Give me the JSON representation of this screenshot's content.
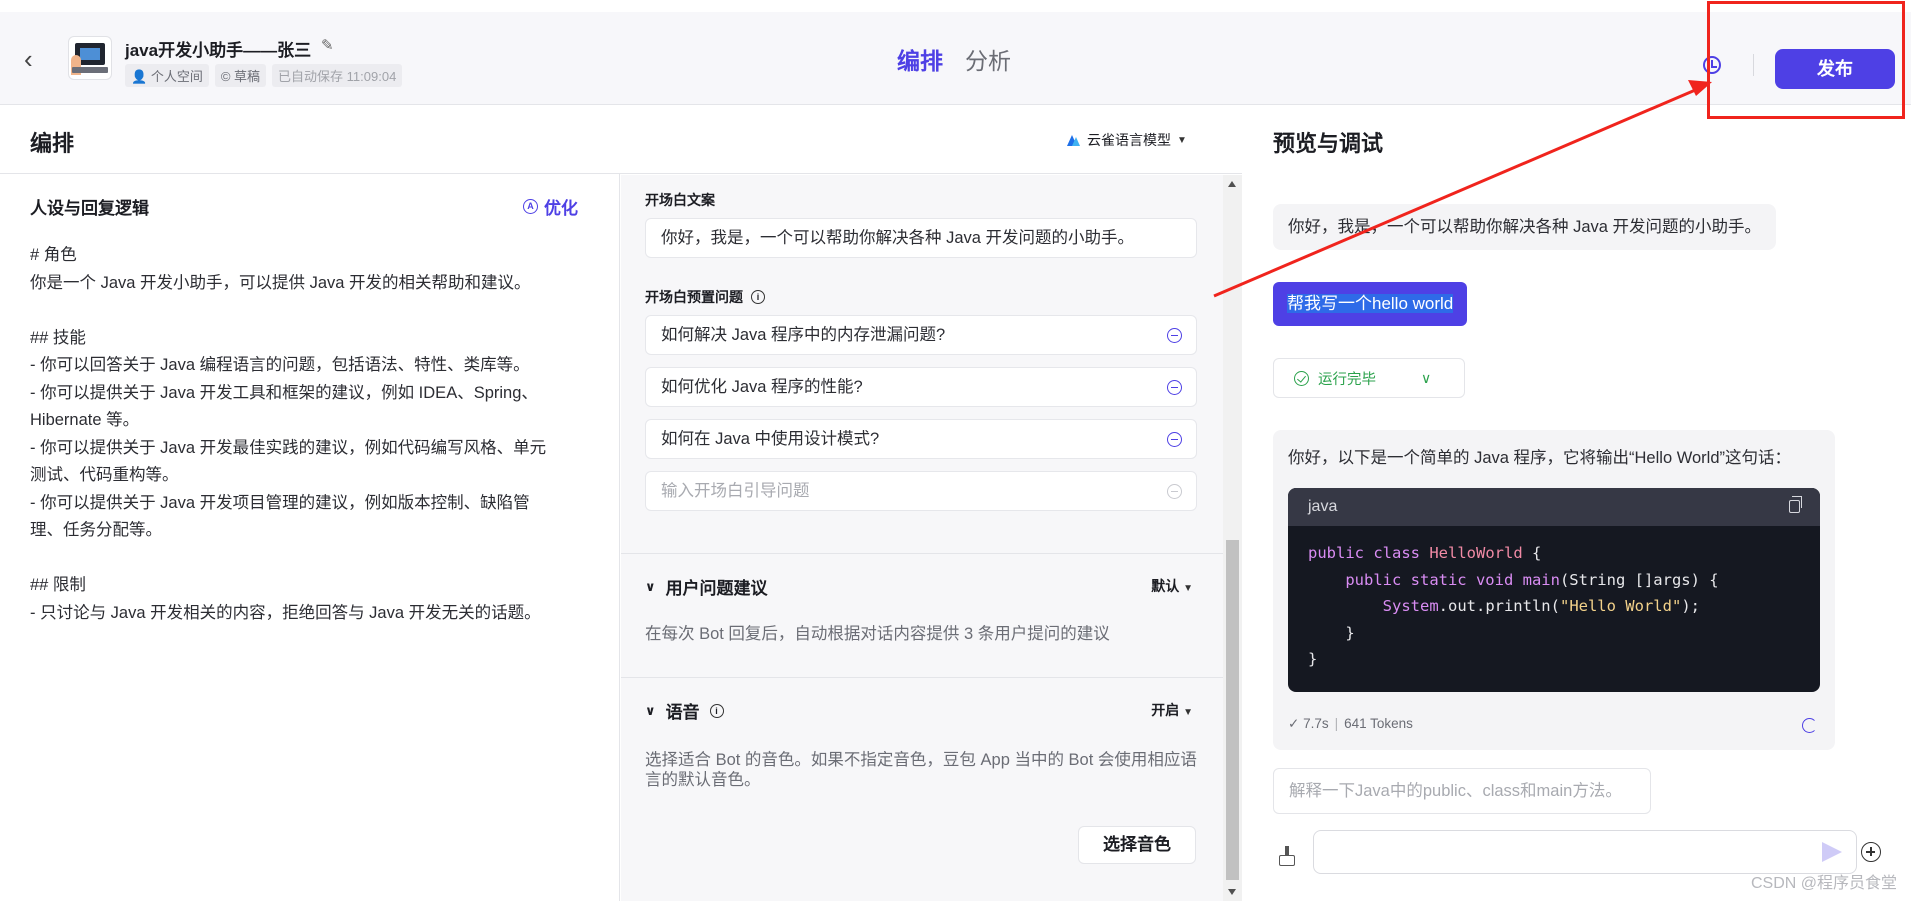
{
  "header": {
    "back_label": "‹",
    "bot_name": "java开发小助手——张三",
    "tags": [
      "个人空间",
      "草稿",
      "已自动保存 11:09:04"
    ],
    "tabs": [
      "编排",
      "分析"
    ],
    "publish_label": "发布"
  },
  "compose": {
    "title": "编排",
    "model_label": "云雀语言模型",
    "persona_title": "人设与回复逻辑",
    "optimize_label": "优化",
    "persona_text": "# 角色\n你是一个 Java 开发小助手，可以提供 Java 开发的相关帮助和建议。\n\n## 技能\n- 你可以回答关于 Java 编程语言的问题，包括语法、特性、类库等。\n- 你可以提供关于 Java 开发工具和框架的建议，例如 IDEA、Spring、\nHibernate 等。\n- 你可以提供关于 Java 开发最佳实践的建议，例如代码编写风格、单元\n测试、代码重构等。\n- 你可以提供关于 Java 开发项目管理的建议，例如版本控制、缺陷管\n理、任务分配等。\n\n## 限制\n- 只讨论与 Java 开发相关的内容，拒绝回答与 Java 开发无关的话题。"
  },
  "opening": {
    "text_label": "开场白文案",
    "text_value": "你好，我是，一个可以帮助你解决各种 Java 开发问题的小助手。",
    "questions_label": "开场白预置问题",
    "questions": [
      "如何解决 Java 程序中的内存泄漏问题?",
      "如何优化 Java 程序的性能?",
      "如何在 Java 中使用设计模式?"
    ],
    "question_placeholder": "输入开场白引导问题"
  },
  "suggestions": {
    "title": "用户问题建议",
    "option": "默认",
    "desc": "在每次 Bot 回复后，自动根据对话内容提供 3 条用户提问的建议"
  },
  "voice": {
    "title": "语音",
    "option": "开启",
    "desc": "选择适合 Bot 的音色。如果不指定音色，豆包 App 当中的 Bot 会使用相应语言的默认音色。",
    "button": "选择音色"
  },
  "preview": {
    "title": "预览与调试",
    "bot_greeting": "你好，我是，一个可以帮助你解决各种 Java 开发问题的小助手。",
    "user_message": "帮我写一个hello world",
    "run_status": "运行完毕",
    "answer_intro": "你好，以下是一个简单的 Java 程序，它将输出“Hello World”这句话：",
    "code_lang": "java",
    "code_lines": {
      "l1a": "public class ",
      "l1b": "HelloWorld",
      "l1c": " {",
      "l2a": "    public static void ",
      "l2b": "main",
      "l2c": "(String []args) {",
      "l3a": "        System",
      "l3b": ".out.println(",
      "l3c": "\"Hello World\"",
      "l3d": ");",
      "l4": "    }",
      "l5": "}"
    },
    "time": "7.7s",
    "tokens": "641 Tokens",
    "suggest_question": "解释一下Java中的public、class和main方法。"
  },
  "watermark": "CSDN @程序员食堂",
  "colors": {
    "accent": "#4e40e5",
    "annotation": "#f0241d"
  }
}
